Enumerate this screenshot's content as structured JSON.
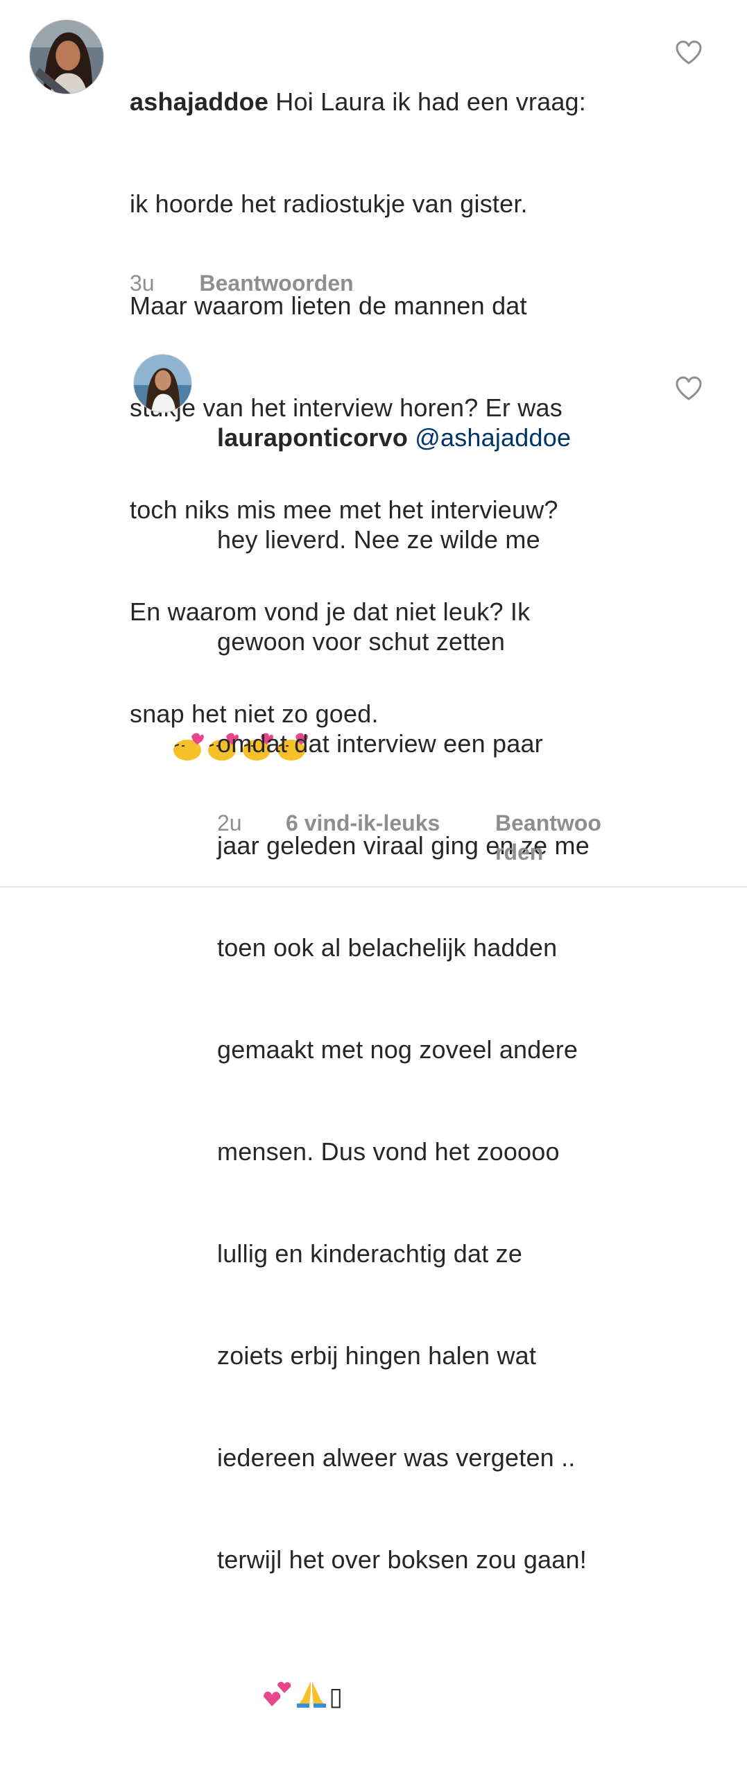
{
  "comments": [
    {
      "username": "ashajaddoe",
      "text": "Hoi Laura ik had een vraag: ik hoorde het radiostukje van gister. Maar waarom lieten de mannen dat stukje van het interview horen? Er was toch niks mis mee met het intervieuw? En waarom vond je dat niet leuk? Ik snap het niet zo goed.",
      "lines": [
        "Hoi Laura ik had een vraag:",
        "ik hoorde het radiostukje van gister.",
        "Maar waarom lieten de mannen dat",
        "stukje van het interview horen? Er was",
        "toch niks mis mee met het intervieuw?",
        "En waarom vond je dat niet leuk? Ik",
        "snap het niet zo goed."
      ],
      "emojis": [
        "kissing-face-heart-icon",
        "kissing-face-heart-icon",
        "kissing-face-heart-icon",
        "kissing-face-heart-icon"
      ],
      "time": "3u",
      "reply_label": "Beantwoorden",
      "like_icon": "heart-outline-icon"
    },
    {
      "username": "lauraponticorvo",
      "mention": "@ashajaddoe",
      "lines": [
        "hey lieverd. Nee ze wilde me",
        "gewoon voor schut zetten",
        "omdat dat interview een paar",
        "jaar geleden viraal ging en ze me",
        "toen ook al belachelijk hadden",
        "gemaakt met nog zoveel andere",
        "mensen. Dus vond het zooooo",
        "lullig en kinderachtig dat ze",
        "zoiets erbij hingen halen wat",
        "iedereen alweer was vergeten ..",
        "terwijl het over boksen zou gaan!"
      ],
      "emojis": [
        "two-hearts-icon",
        "folded-hands-icon",
        "missing-glyph-icon"
      ],
      "missing_glyph": "▯",
      "time": "2u",
      "likes_label": "6 vind-ik-leuks",
      "reply_label_line1": "Beantwoo",
      "reply_label_line2": "rden",
      "like_icon": "heart-outline-icon"
    }
  ],
  "colors": {
    "text": "#262626",
    "meta": "#8e8e8e",
    "mention": "#003569",
    "heart_stroke": "#8e8e8e"
  }
}
